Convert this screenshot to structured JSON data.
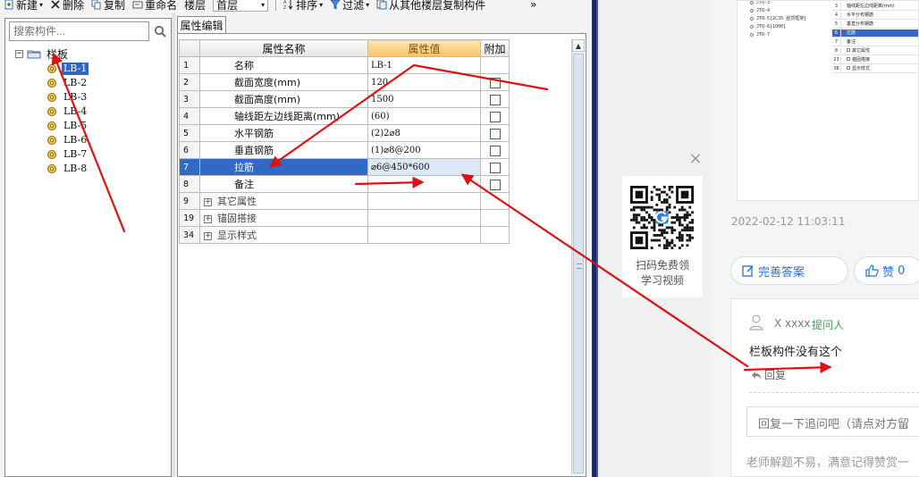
{
  "toolbar": {
    "new_label": "新建",
    "delete_label": "删除",
    "copy_label": "复制",
    "rename_label": "重命名",
    "floor_label": "楼层",
    "floor_value": "首层",
    "sort_label": "排序",
    "filter_label": "过滤",
    "copy_from_floor_label": "从其他楼层复制构件",
    "overflow": "»"
  },
  "search": {
    "placeholder": "搜索构件..."
  },
  "tree": {
    "root": "栏板",
    "items": [
      "LB-1",
      "LB-2",
      "LB-3",
      "LB-4",
      "LB-5",
      "LB-6",
      "LB-7",
      "LB-8"
    ],
    "selected": "LB-1"
  },
  "property_tab": "属性编辑",
  "grid": {
    "headers": {
      "name": "属性名称",
      "value": "属性值",
      "extra": "附加"
    },
    "rows": [
      {
        "num": "1",
        "name": "名称",
        "value": "LB-1",
        "check": false,
        "group": false
      },
      {
        "num": "2",
        "name": "截面宽度(mm)",
        "value": "120",
        "check": true,
        "group": false
      },
      {
        "num": "3",
        "name": "截面高度(mm)",
        "value": "1500",
        "check": true,
        "group": false
      },
      {
        "num": "4",
        "name": "轴线距左边线距离(mm)",
        "value": "(60)",
        "check": true,
        "group": false
      },
      {
        "num": "5",
        "name": "水平钢筋",
        "value": "(2)2⌀8",
        "check": true,
        "group": false
      },
      {
        "num": "6",
        "name": "垂直钢筋",
        "value": "(1)⌀8@200",
        "check": true,
        "group": false
      },
      {
        "num": "7",
        "name": "拉筋",
        "value": "⌀6@450*600",
        "check": true,
        "group": false,
        "selected": true
      },
      {
        "num": "8",
        "name": "备注",
        "value": "",
        "check": true,
        "group": false
      },
      {
        "num": "9",
        "name": "其它属性",
        "value": "",
        "check": false,
        "group": true
      },
      {
        "num": "19",
        "name": "锚固搭接",
        "value": "",
        "check": false,
        "group": true
      },
      {
        "num": "34",
        "name": "显示样式",
        "value": "",
        "check": false,
        "group": true
      }
    ]
  },
  "thumbnail": {
    "tree_items": [
      "JTQ-3",
      "JTQ-4",
      "JTQ-5[2C35 屋顶框架]",
      "JTQ-6[1000]",
      "JTQ-7"
    ],
    "grid_rows": [
      {
        "num": "3",
        "label": "轴线距左边线距离(mm)",
        "expand": false
      },
      {
        "num": "4",
        "label": "水平分布钢筋",
        "expand": false
      },
      {
        "num": "5",
        "label": "垂直分布钢筋",
        "expand": false
      },
      {
        "num": "6",
        "label": "拉筋",
        "expand": false,
        "selected": true
      },
      {
        "num": "7",
        "label": "备注",
        "expand": false
      },
      {
        "num": "8",
        "label": "其它属性",
        "expand": true
      },
      {
        "num": "23",
        "label": "锚固搭接",
        "expand": true
      },
      {
        "num": "38",
        "label": "显示样式",
        "expand": true
      }
    ]
  },
  "qr": {
    "caption_line1": "扫码免费领",
    "caption_line2": "学习视频",
    "close": "×"
  },
  "post": {
    "timestamp": "2022-02-12 11:03:11",
    "improve_answer": "完善答案",
    "like_label": "赞",
    "like_count": "0"
  },
  "followup": {
    "asker_name": "X xxxx",
    "asker_tag": "提问人",
    "comment": "栏板构件没有这个",
    "reply_link": "回复",
    "reply_placeholder": "回复一下追问吧（请点对方留",
    "encourage_text": "老师解题不易，满意记得赞赏一"
  },
  "colors": {
    "selection_blue": "#2f6bc6",
    "header_highlight": "#f7c467",
    "link_blue": "#2f6fd6",
    "tag_green": "#3ca55c",
    "annotation_red": "#e01010"
  }
}
